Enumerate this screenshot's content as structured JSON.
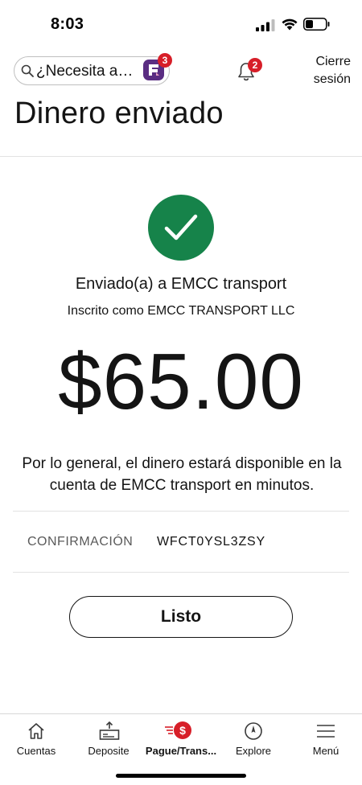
{
  "status_bar": {
    "time": "8:03"
  },
  "header": {
    "search_placeholder": "¿Necesita a…",
    "fargo_badge_count": "3",
    "notifications_count": "2",
    "logout_label": "Cierre sesión"
  },
  "page": {
    "title": "Dinero enviado"
  },
  "confirmation": {
    "sent_to": "Enviado(a) a EMCC transport",
    "enrolled_as": "Inscrito como EMCC TRANSPORT LLC",
    "amount": "$65.00",
    "availability_message": "Por lo general, el dinero estará disponible en la cuenta de EMCC transport en minutos.",
    "confirmation_label": "CONFIRMACIÓN",
    "confirmation_number": "WFCT0YSL3ZSY",
    "done_label": "Listo"
  },
  "bottom_nav": {
    "items": [
      {
        "label": "Cuentas",
        "icon": "home-icon"
      },
      {
        "label": "Deposite",
        "icon": "deposit-icon"
      },
      {
        "label": "Pague/Trans...",
        "icon": "pay-transfer-icon",
        "badge": "$",
        "active": true
      },
      {
        "label": "Explore",
        "icon": "compass-icon"
      },
      {
        "label": "Menú",
        "icon": "hamburger-menu-icon"
      }
    ]
  },
  "colors": {
    "success_green": "#16834a",
    "brand_red": "#d71e28",
    "fargo_purple": "#5a2d82"
  }
}
